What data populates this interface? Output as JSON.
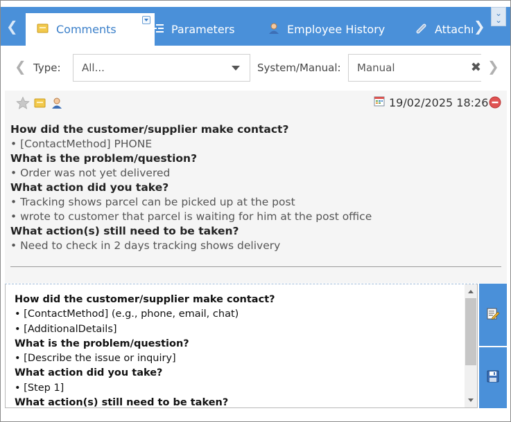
{
  "tabs": [
    {
      "label": "Comments",
      "icon": "comment-icon",
      "active": true
    },
    {
      "label": "Parameters",
      "icon": "parameters-icon",
      "active": false
    },
    {
      "label": "Employee History",
      "icon": "user-icon",
      "active": false
    },
    {
      "label": "Attachı",
      "icon": "paperclip-icon",
      "active": false
    }
  ],
  "filter": {
    "type_label": "Type:",
    "type_value": "All...",
    "system_manual_label": "System/Manual:",
    "system_manual_value": "Manual"
  },
  "entry": {
    "datetime": "19/02/2025 18:26",
    "lines": [
      {
        "kind": "q",
        "text": "How did the customer/supplier make contact?"
      },
      {
        "kind": "a",
        "text": "• [ContactMethod]  PHONE"
      },
      {
        "kind": "q",
        "text": "What is the problem/question?"
      },
      {
        "kind": "a",
        "text": "•  Order was not yet delivered"
      },
      {
        "kind": "q",
        "text": "What action did you take?"
      },
      {
        "kind": "a",
        "text": "• Tracking shows parcel can be picked up at the post"
      },
      {
        "kind": "a",
        "text": "• wrote to customer that parcel is waiting for him at the post office"
      },
      {
        "kind": "q",
        "text": "What action(s) still need to be taken?"
      },
      {
        "kind": "a",
        "text": "• Need to check in 2 days tracking shows delivery"
      }
    ]
  },
  "editor": {
    "lines": [
      {
        "kind": "q",
        "text": "How did the customer/supplier make contact?"
      },
      {
        "kind": "a",
        "text": "• [ContactMethod] (e.g., phone, email, chat)"
      },
      {
        "kind": "a",
        "text": "• [AdditionalDetails]"
      },
      {
        "kind": "q",
        "text": "What is the problem/question?"
      },
      {
        "kind": "a",
        "text": "• [Describe the issue or inquiry]"
      },
      {
        "kind": "q",
        "text": "What action did you take?"
      },
      {
        "kind": "a",
        "text": "• [Step 1]"
      },
      {
        "kind": "q",
        "text": "What action(s) still need to be taken?"
      }
    ]
  },
  "colors": {
    "accent": "#4a90d9",
    "entry_bg": "#f5f5f5"
  }
}
